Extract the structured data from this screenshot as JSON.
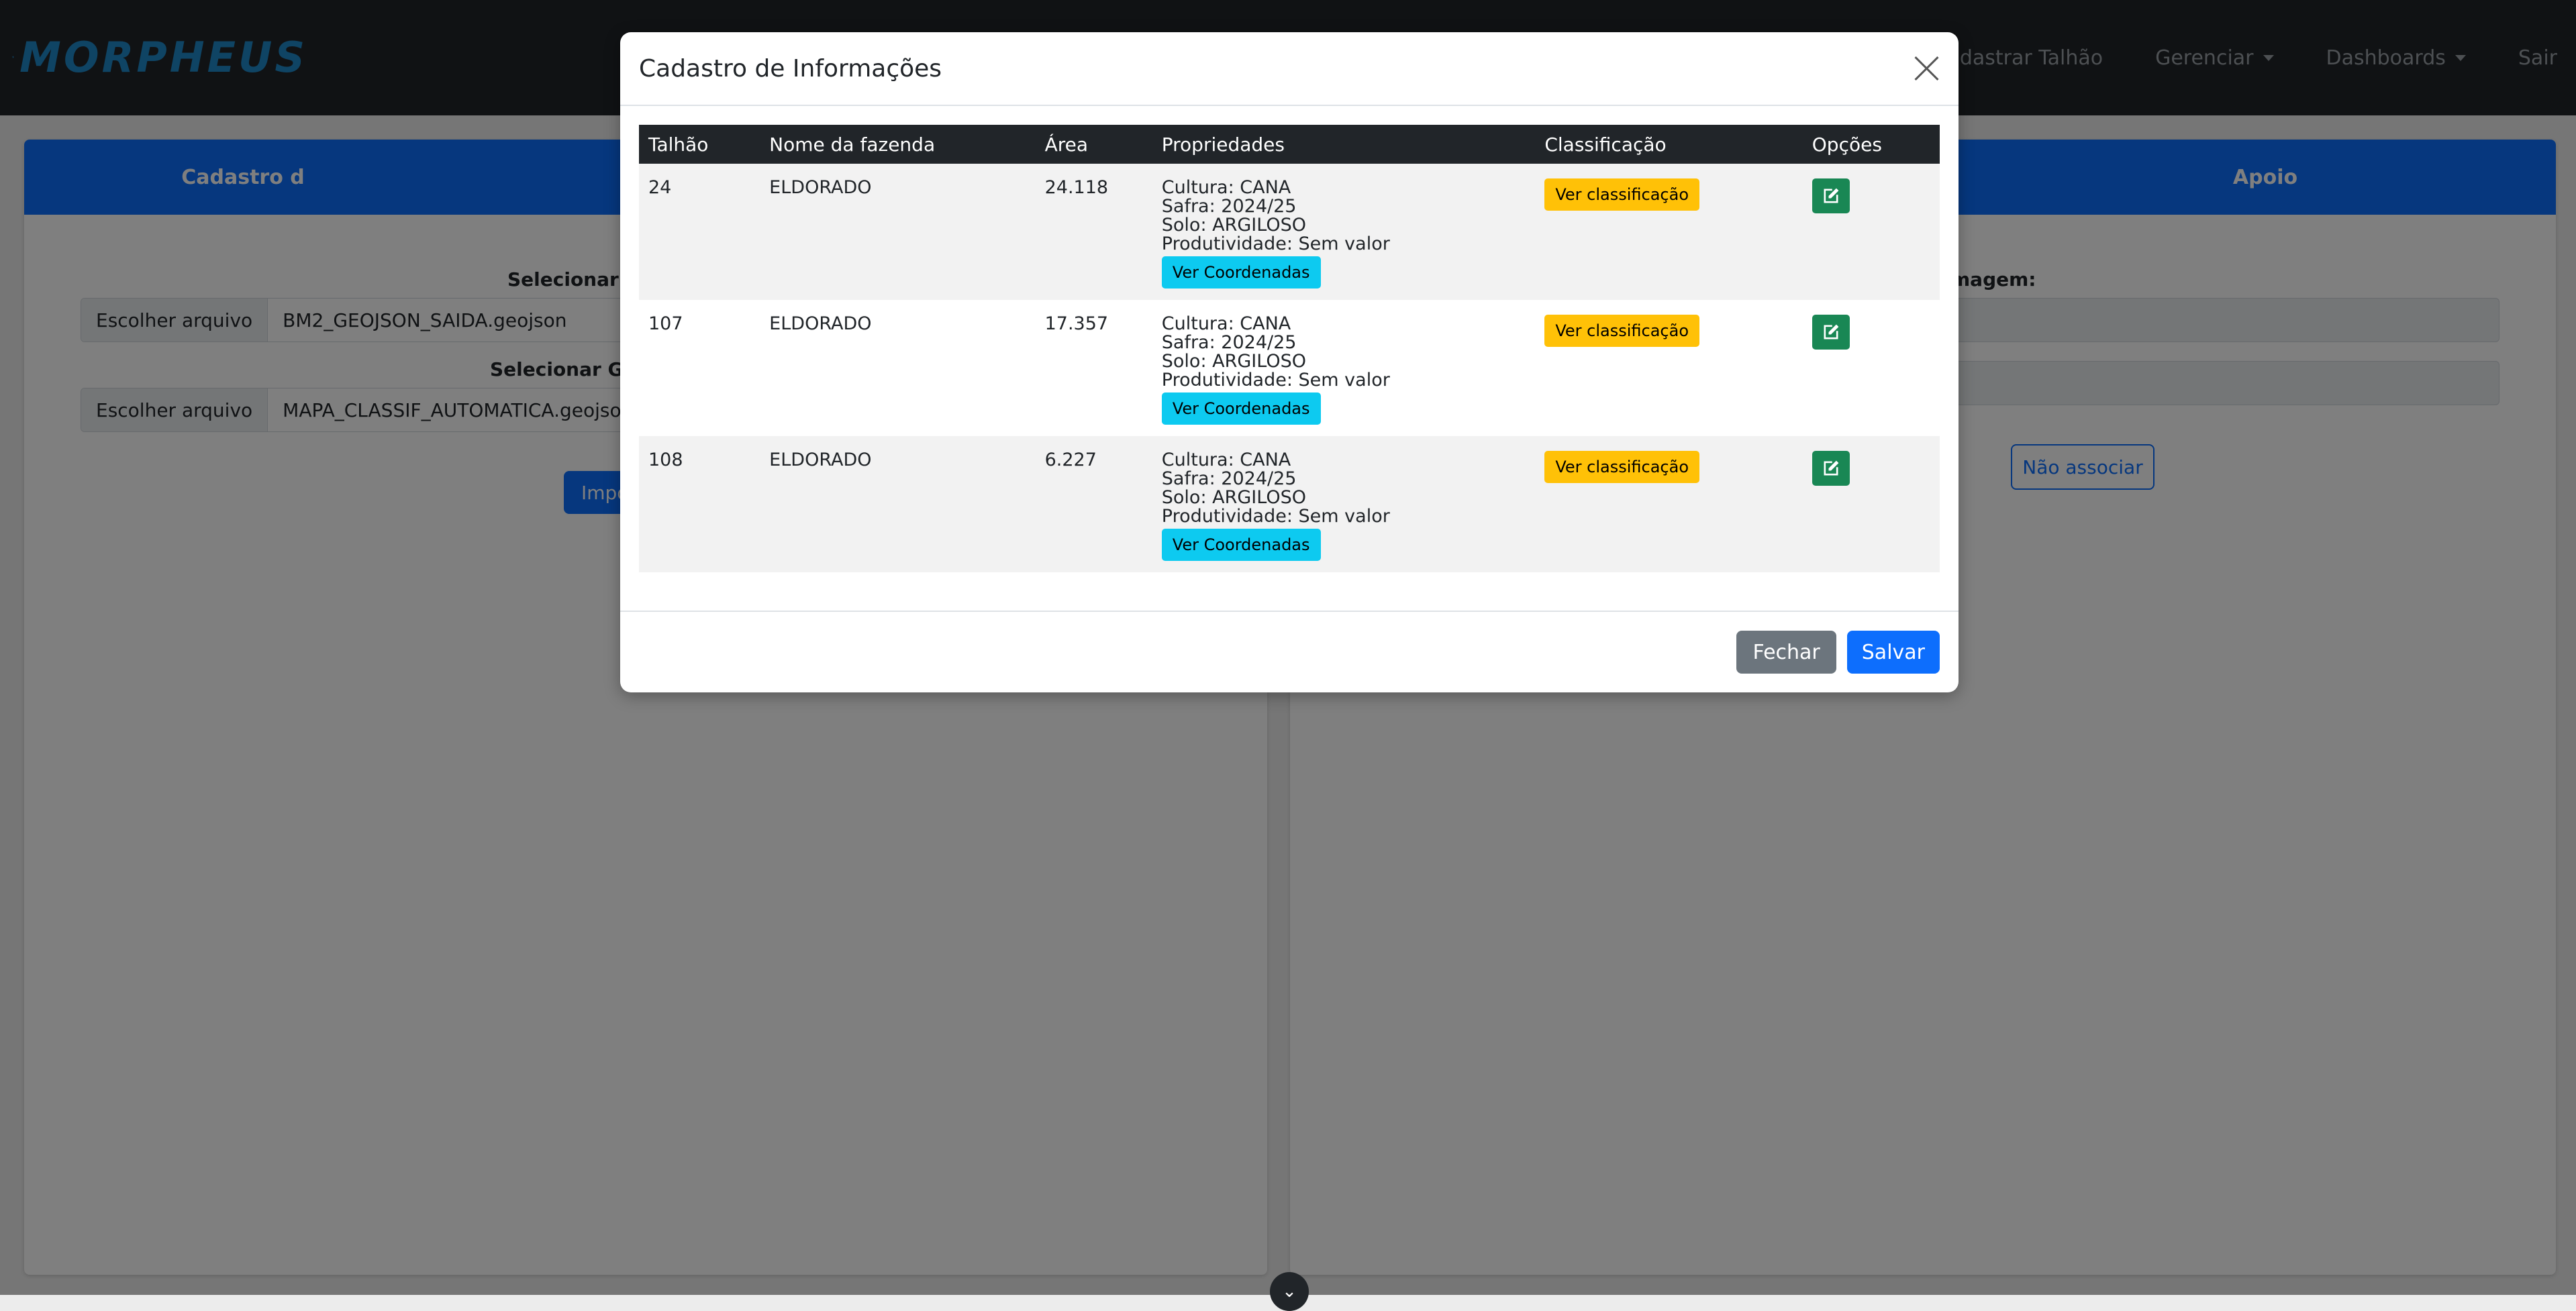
{
  "navbar": {
    "brand": "MORPHEUS",
    "links": [
      {
        "label": "Cadastrar Talhão",
        "dropdown": false
      },
      {
        "label": "Gerenciar",
        "dropdown": true
      },
      {
        "label": "Dashboards",
        "dropdown": true
      },
      {
        "label": "Sair",
        "dropdown": false
      }
    ]
  },
  "background": {
    "left_panel": {
      "header": "Cadastro d",
      "label1": "Selecionar G",
      "file1_button": "Escolher arquivo",
      "file1_name": "BM2_GEOJSON_SAIDA.geojson",
      "label2": "Selecionar Ge",
      "file2_button": "Escolher arquivo",
      "file2_name": "MAPA_CLASSIF_AUTOMATICA.geojson",
      "import_button": "Impo"
    },
    "right_panel": {
      "header": "Apoio",
      "label": "magem:",
      "no_associate_button": "Não associar"
    }
  },
  "modal": {
    "title": "Cadastro de Informações",
    "columns": [
      "Talhão",
      "Nome da fazenda",
      "Área",
      "Propriedades",
      "Classificação",
      "Opções"
    ],
    "rows": [
      {
        "talhao": "24",
        "fazenda": "ELDORADO",
        "area": "24.118",
        "cultura": "Cultura: CANA",
        "safra": "Safra: 2024/25",
        "solo": "Solo: ARGILOSO",
        "produtividade": "Produtividade: Sem valor"
      },
      {
        "talhao": "107",
        "fazenda": "ELDORADO",
        "area": "17.357",
        "cultura": "Cultura: CANA",
        "safra": "Safra: 2024/25",
        "solo": "Solo: ARGILOSO",
        "produtividade": "Produtividade: Sem valor"
      },
      {
        "talhao": "108",
        "fazenda": "ELDORADO",
        "area": "6.227",
        "cultura": "Cultura: CANA",
        "safra": "Safra: 2024/25",
        "solo": "Solo: ARGILOSO",
        "produtividade": "Produtividade: Sem valor"
      }
    ],
    "coord_button": "Ver Coordenadas",
    "class_button": "Ver classificação",
    "edit_icon": "edit-icon",
    "close_label": "Fechar",
    "save_label": "Salvar"
  },
  "colors": {
    "navbar": "#212529",
    "primary": "#0d6efd",
    "info": "#0dcaf0",
    "warning": "#ffc107",
    "success": "#198754",
    "secondary": "#6c757d"
  }
}
